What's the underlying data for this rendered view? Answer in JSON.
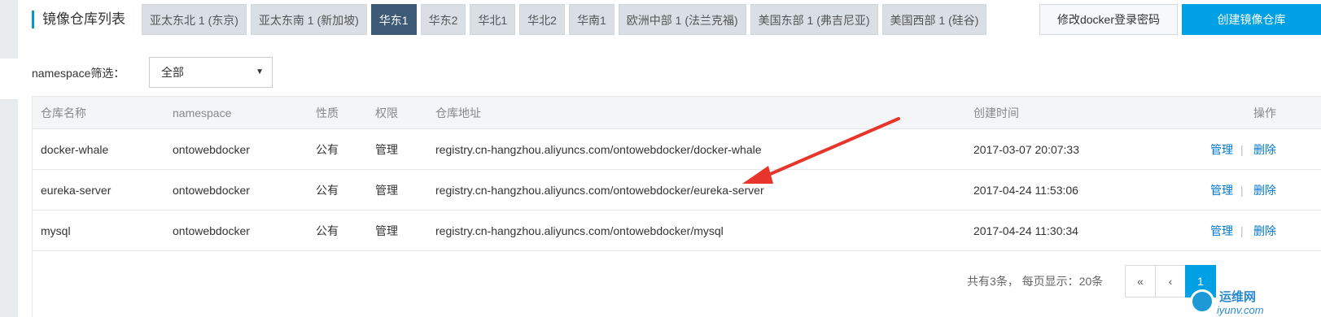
{
  "header": {
    "title": "镜像仓库列表",
    "regions": [
      {
        "label": "亚太东北 1 (东京)",
        "active": false
      },
      {
        "label": "亚太东南 1 (新加坡)",
        "active": false
      },
      {
        "label": "华东1",
        "active": true
      },
      {
        "label": "华东2",
        "active": false
      },
      {
        "label": "华北1",
        "active": false
      },
      {
        "label": "华北2",
        "active": false
      },
      {
        "label": "华南1",
        "active": false
      },
      {
        "label": "欧洲中部 1 (法兰克福)",
        "active": false
      },
      {
        "label": "美国东部 1 (弗吉尼亚)",
        "active": false
      },
      {
        "label": "美国西部 1 (硅谷)",
        "active": false
      }
    ],
    "change_password_label": "修改docker登录密码",
    "create_label": "创建镜像仓库"
  },
  "filter": {
    "label": "namespace筛选：",
    "selected": "全部",
    "caret": "▼"
  },
  "table": {
    "columns": {
      "name": "仓库名称",
      "namespace": "namespace",
      "type": "性质",
      "permission": "权限",
      "address": "仓库地址",
      "created": "创建时间",
      "operations": "操作"
    },
    "rows": [
      {
        "name": "docker-whale",
        "namespace": "ontowebdocker",
        "type": "公有",
        "permission": "管理",
        "address": "registry.cn-hangzhou.aliyuncs.com/ontowebdocker/docker-whale",
        "created": "2017-03-07 20:07:33",
        "manage": "管理",
        "separator": "|",
        "delete": "删除"
      },
      {
        "name": "eureka-server",
        "namespace": "ontowebdocker",
        "type": "公有",
        "permission": "管理",
        "address": "registry.cn-hangzhou.aliyuncs.com/ontowebdocker/eureka-server",
        "created": "2017-04-24 11:53:06",
        "manage": "管理",
        "separator": "|",
        "delete": "删除"
      },
      {
        "name": "mysql",
        "namespace": "ontowebdocker",
        "type": "公有",
        "permission": "管理",
        "address": "registry.cn-hangzhou.aliyuncs.com/ontowebdocker/mysql",
        "created": "2017-04-24 11:30:34",
        "manage": "管理",
        "separator": "|",
        "delete": "删除"
      }
    ]
  },
  "pagination": {
    "summary": "共有3条， 每页显示：20条",
    "first": "«",
    "prev": "‹",
    "current": "1"
  },
  "annotation": {
    "arrow_color": "#e8352b"
  },
  "watermark": {
    "name": "运维网",
    "url": "iyunv.com"
  }
}
